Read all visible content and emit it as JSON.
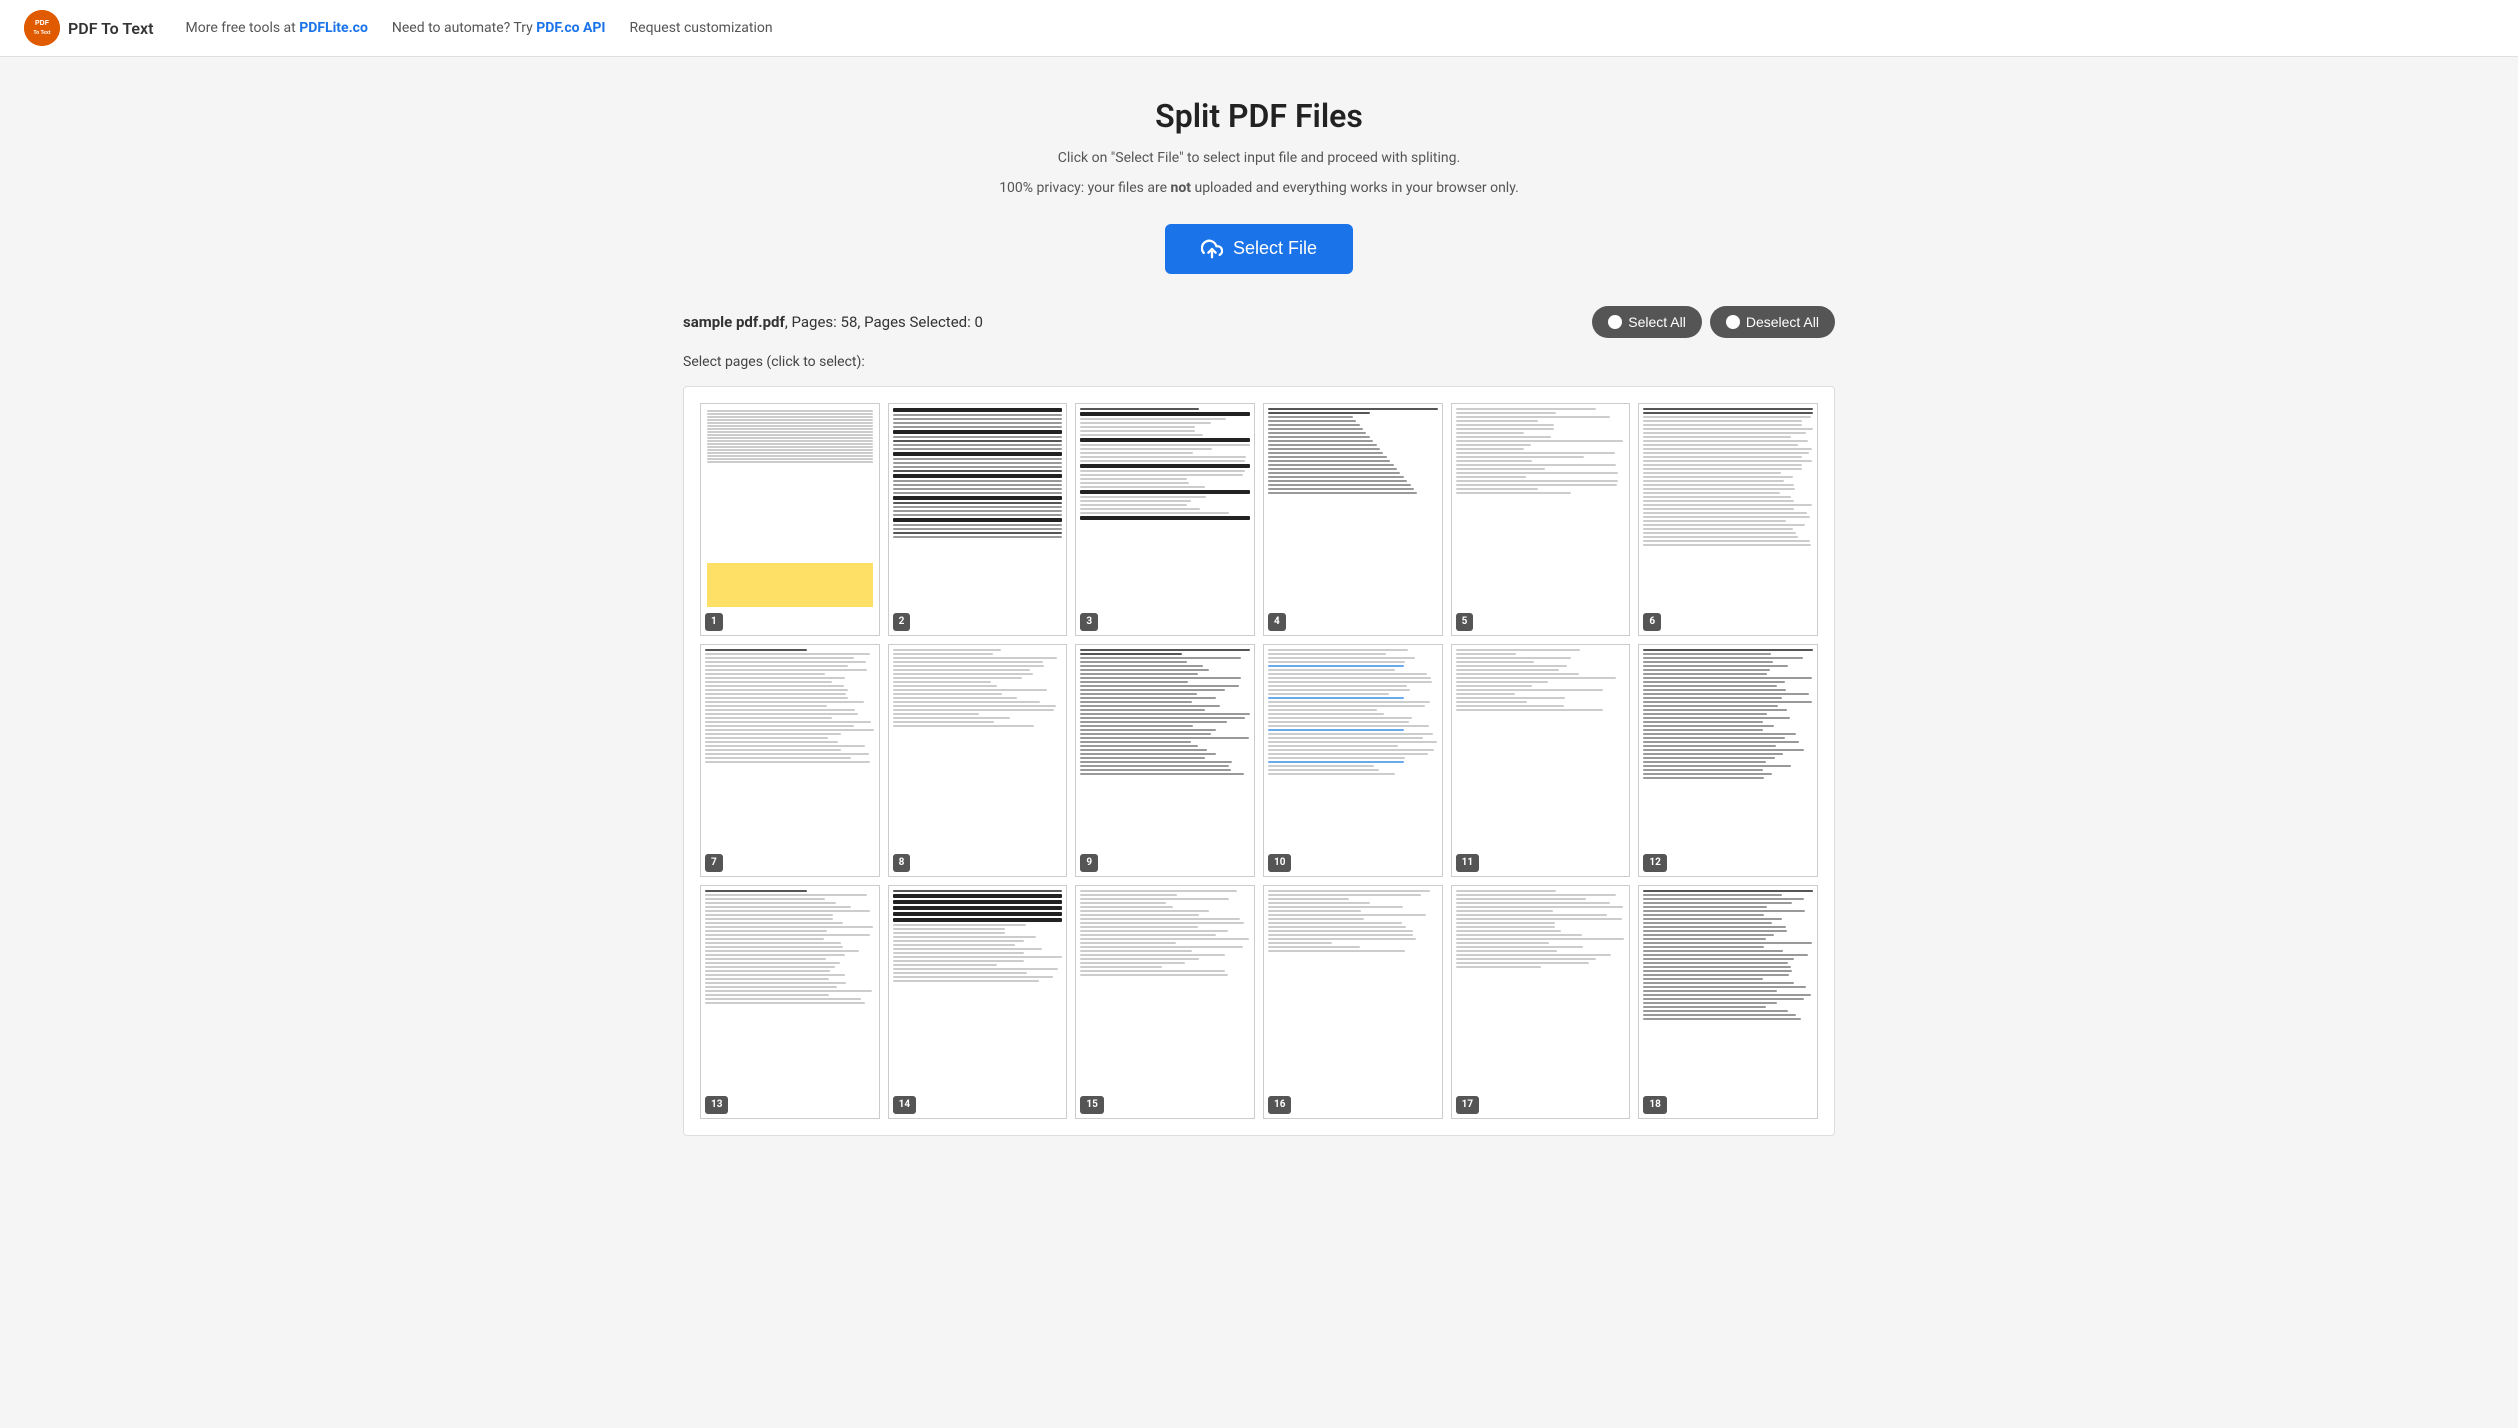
{
  "header": {
    "logo_text": "PDF To Text",
    "logo_icon_text": "PDF",
    "nav_items": [
      {
        "id": "pdflite",
        "text": "More free tools at ",
        "link_text": "PDFLite.co"
      },
      {
        "id": "api",
        "text": "Need to automate? Try ",
        "link_text": "PDF.co API"
      },
      {
        "id": "custom",
        "text": "Request customization"
      }
    ]
  },
  "hero": {
    "title": "Split PDF Files",
    "subtitle1": "Click on \"Select File\" to select input file and proceed with spliting.",
    "subtitle2_prefix": "100% privacy: your files are ",
    "subtitle2_bold": "not",
    "subtitle2_suffix": " uploaded and everything works in your browser only.",
    "select_button": "Select File"
  },
  "file_info": {
    "filename": "sample pdf.pdf",
    "pages_label": "Pages:",
    "pages_count": "58",
    "selected_label": "Pages Selected:",
    "selected_count": "0",
    "select_all_label": "Select All",
    "deselect_all_label": "Deselect All"
  },
  "pages_section": {
    "instruction": "Select pages (click to select):",
    "pages": [
      {
        "num": 1,
        "type": "yellow_highlight"
      },
      {
        "num": 2,
        "type": "form_dense"
      },
      {
        "num": 3,
        "type": "form_medium"
      },
      {
        "num": 4,
        "type": "table"
      },
      {
        "num": 5,
        "type": "form_light"
      },
      {
        "num": 6,
        "type": "dense_text"
      },
      {
        "num": 7,
        "type": "text_block"
      },
      {
        "num": 8,
        "type": "text_light"
      },
      {
        "num": 9,
        "type": "text_columns"
      },
      {
        "num": 10,
        "type": "text_blue"
      },
      {
        "num": 11,
        "type": "text_sparse"
      },
      {
        "num": 12,
        "type": "text_dense2"
      },
      {
        "num": 13,
        "type": "text_block"
      },
      {
        "num": 14,
        "type": "table2"
      },
      {
        "num": 15,
        "type": "form_light"
      },
      {
        "num": 16,
        "type": "text_sparse"
      },
      {
        "num": 17,
        "type": "text_light"
      },
      {
        "num": 18,
        "type": "text_dense2"
      }
    ]
  },
  "colors": {
    "brand_orange": "#e05a00",
    "brand_blue": "#1a73e8",
    "badge_bg": "#555555",
    "yellow": "#ffe066"
  }
}
